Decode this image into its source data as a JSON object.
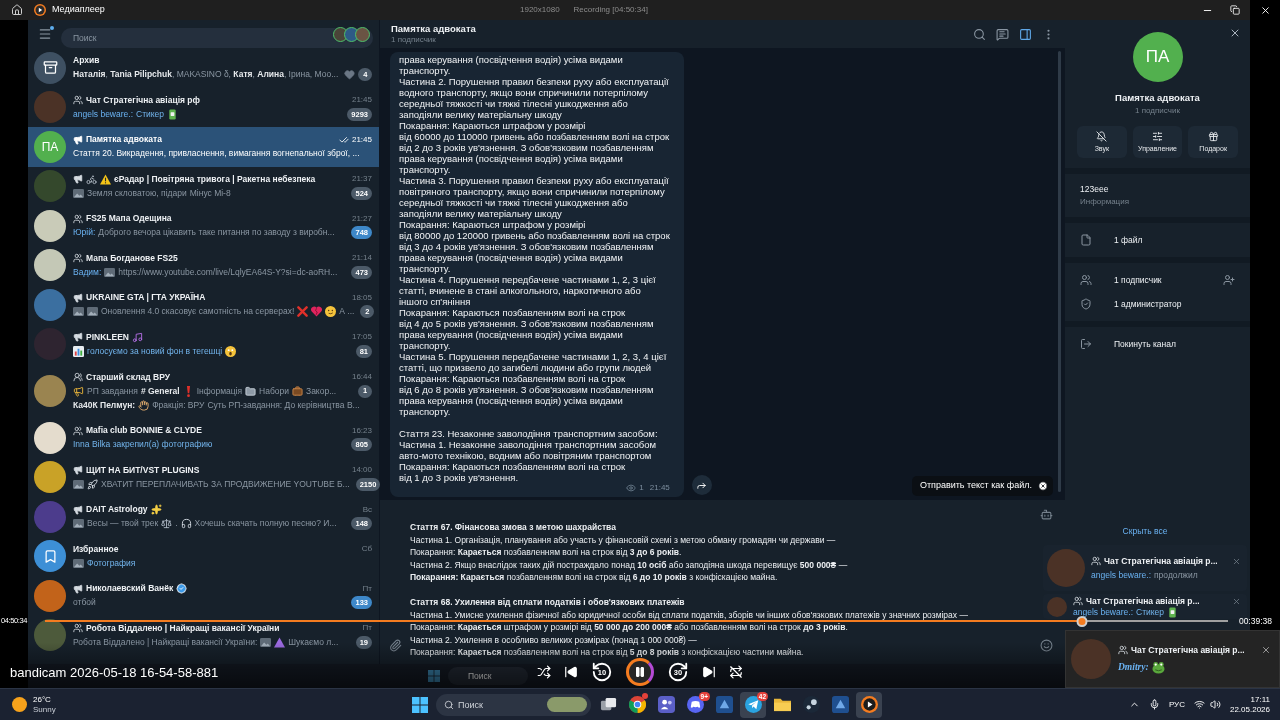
{
  "window": {
    "title": "Медиаплеер",
    "recording": {
      "resolution": "1920x1080",
      "status": "Recording [04:50:34]"
    }
  },
  "sidebar": {
    "menu_badge": true,
    "search": {
      "placeholder": "Поиск"
    },
    "stories": [
      {
        "color": "#4a4438"
      },
      {
        "color": "#2e5a86"
      },
      {
        "color": "#6a5444"
      }
    ],
    "chats": [
      {
        "avatar": {
          "kind": "archive",
          "color": "#3e5062"
        },
        "kind": "plain",
        "title": [
          {
            "kind": "text",
            "text": "Архив"
          }
        ],
        "read": false,
        "preview": [
          [
            {
              "kind": "rich",
              "text": "**Наталія**, **Tania Pilipchuk**, MAKASINO δ, **Катя**, **Алина**, Ірина, Моо..."
            }
          ]
        ],
        "extras": [
          {
            "kind": "heart"
          }
        ],
        "badge": {
          "text": "4",
          "muted": true
        },
        "selected": false
      },
      {
        "avatar": {
          "kind": "photo",
          "color": "#4b3226"
        },
        "kind": "group",
        "title": [
          {
            "kind": "text",
            "text": "Чат Стратегічна авіація рф"
          }
        ],
        "time": "21:45",
        "read": false,
        "preview": [
          [
            {
              "kind": "sender",
              "text": "angels beware.:"
            },
            {
              "kind": "media",
              "text": "Стикер"
            },
            {
              "kind": "sticker"
            }
          ]
        ],
        "badge": {
          "text": "9293",
          "muted": true
        },
        "selected": false
      },
      {
        "avatar": {
          "kind": "initials",
          "text": "ПА",
          "color": "#52b04e"
        },
        "kind": "channel",
        "title": [
          {
            "kind": "text",
            "text": "Памятка адвоката"
          }
        ],
        "time": "21:45",
        "read": true,
        "preview": [
          [
            {
              "kind": "text",
              "text": "Стаття 20. Викрадення, привласнення, вимагання вогнепальної зброї, ..."
            }
          ]
        ],
        "selected": true
      },
      {
        "avatar": {
          "kind": "photo",
          "color": "#34482c"
        },
        "kind": "channel",
        "title": [
          {
            "kind": "bike"
          },
          {
            "kind": "warning"
          },
          {
            "kind": "text",
            "text": "єРадар | Повітряна тривога | Ракетна небезпека"
          }
        ],
        "time": "21:37",
        "read": false,
        "preview": [
          [
            {
              "kind": "thumb"
            },
            {
              "kind": "text",
              "text": "Земля скловатою, підари"
            },
            {
              "kind": "text",
              "text": "Мінус Мі-8"
            }
          ]
        ],
        "badge": {
          "text": "524",
          "muted": true
        },
        "selected": false
      },
      {
        "avatar": {
          "kind": "photo",
          "color": "#c9cbb8"
        },
        "kind": "group",
        "title": [
          {
            "kind": "text",
            "text": "FS25 Мапа Одещина"
          }
        ],
        "time": "21:27",
        "read": false,
        "preview": [
          [
            {
              "kind": "sender",
              "text": "Юрій:"
            },
            {
              "kind": "text",
              "text": "Доброго вечора цікавить таке питання по заводу з виробн..."
            }
          ]
        ],
        "badge": {
          "text": "748",
          "muted": false
        },
        "selected": false
      },
      {
        "avatar": {
          "kind": "photo",
          "color": "#c4c8b6"
        },
        "kind": "group",
        "title": [
          {
            "kind": "text",
            "text": "Мапа Богданове FS25"
          }
        ],
        "time": "21:14",
        "read": false,
        "preview": [
          [
            {
              "kind": "sender",
              "text": "Вадим:"
            },
            {
              "kind": "thumb"
            },
            {
              "kind": "text",
              "text": "https://www.youtube.com/live/LqlyEA64S-Y?si=dc-aoRH..."
            }
          ]
        ],
        "badge": {
          "text": "473",
          "muted": true
        },
        "selected": false
      },
      {
        "avatar": {
          "kind": "photo",
          "color": "#3b6fa0"
        },
        "kind": "channel",
        "title": [
          {
            "kind": "text",
            "text": "UKRAINE GTA | ГТА УКРАЇНА"
          }
        ],
        "time": "18:05",
        "read": false,
        "preview": [
          [
            {
              "kind": "thumb"
            },
            {
              "kind": "thumb"
            },
            {
              "kind": "text",
              "text": "Оновлення 4.0 скасовує самотність на серверах!"
            },
            {
              "kind": "cross"
            },
            {
              "kind": "brokenheart"
            },
            {
              "kind": "face"
            },
            {
              "kind": "text",
              "text": "А ..."
            }
          ]
        ],
        "badge": {
          "text": "2",
          "muted": true
        },
        "selected": false
      },
      {
        "avatar": {
          "kind": "photo",
          "color": "#2e2430"
        },
        "kind": "channel",
        "title": [
          {
            "kind": "text",
            "text": "PINKLEEN"
          },
          {
            "kind": "notes"
          }
        ],
        "time": "17:05",
        "read": false,
        "preview": [
          [
            {
              "kind": "chart"
            },
            {
              "kind": "media",
              "text": "голосуємо за новий фон в тегешці"
            },
            {
              "kind": "scream"
            }
          ]
        ],
        "badge": {
          "text": "81",
          "muted": true
        },
        "selected": false
      },
      {
        "avatar": {
          "kind": "photo",
          "color": "#9a8450"
        },
        "kind": "forum",
        "title": [
          {
            "kind": "text",
            "text": "Старший склад ВРУ"
          }
        ],
        "time": "16:44",
        "read": false,
        "preview": [
          [
            {
              "kind": "megaphone"
            },
            {
              "kind": "text",
              "text": "РП завдання"
            },
            {
              "kind": "topic",
              "text": "# General"
            },
            {
              "kind": "exclaim"
            },
            {
              "kind": "text",
              "text": "Інформація"
            },
            {
              "kind": "folder"
            },
            {
              "kind": "text",
              "text": "Набори"
            },
            {
              "kind": "briefcase"
            },
            {
              "kind": "text",
              "text": "Закор..."
            }
          ],
          [
            {
              "kind": "author",
              "text": "Ка40К Пелмун:"
            },
            {
              "kind": "hand"
            },
            {
              "kind": "text",
              "text": "Фракція: ВРУ"
            },
            {
              "kind": "text",
              "text": "Суть РП-завдання: До керівництва В..."
            }
          ]
        ],
        "badge": {
          "text": "1",
          "muted": true
        },
        "selected": false
      },
      {
        "avatar": {
          "kind": "photo",
          "color": "#e4dccd"
        },
        "kind": "group",
        "title": [
          {
            "kind": "text",
            "text": "Mafia club BONNIE & CLYDE"
          }
        ],
        "time": "16:23",
        "read": false,
        "preview": [
          [
            {
              "kind": "media",
              "text": "Inna Bilka закрепил(а) фотографию"
            }
          ]
        ],
        "badge": {
          "text": "805",
          "muted": true
        },
        "selected": false
      },
      {
        "avatar": {
          "kind": "photo",
          "color": "#c9a227"
        },
        "kind": "channel",
        "title": [
          {
            "kind": "text",
            "text": "ЩИТ НА БИТ/VST PLUGINS"
          }
        ],
        "time": "14:00",
        "read": false,
        "preview": [
          [
            {
              "kind": "thumb"
            },
            {
              "kind": "rocket"
            },
            {
              "kind": "text",
              "text": "ХВАТИТ ПЕРЕПЛАЧИВАТЬ ЗА ПРОДВИЖЕНИЕ YOUTUBE Б..."
            }
          ]
        ],
        "badge": {
          "text": "2150",
          "muted": true
        },
        "selected": false
      },
      {
        "avatar": {
          "kind": "photo",
          "color": "#4c3c8c"
        },
        "kind": "channel",
        "title": [
          {
            "kind": "text",
            "text": "DAIT Astrology"
          },
          {
            "kind": "sparkles"
          }
        ],
        "time": "Вс",
        "read": false,
        "preview": [
          [
            {
              "kind": "thumb"
            },
            {
              "kind": "text",
              "text": "Весы — твой трек"
            },
            {
              "kind": "scales"
            },
            {
              "kind": "text",
              "text": "."
            },
            {
              "kind": "headphones"
            },
            {
              "kind": "text",
              "text": "Хочешь скачать полную песню? И..."
            }
          ]
        ],
        "badge": {
          "text": "148",
          "muted": true
        },
        "selected": false
      },
      {
        "avatar": {
          "kind": "bookmark",
          "color": "#3d8fd6"
        },
        "kind": "plain",
        "title": [
          {
            "kind": "text",
            "text": "Избранное"
          }
        ],
        "time": "Сб",
        "read": false,
        "preview": [
          [
            {
              "kind": "thumb"
            },
            {
              "kind": "media",
              "text": "Фотография"
            }
          ]
        ],
        "selected": false
      },
      {
        "avatar": {
          "kind": "photo",
          "color": "#c2631a"
        },
        "kind": "channel",
        "title": [
          {
            "kind": "text",
            "text": "Николаевский Ванёк"
          },
          {
            "kind": "verified"
          }
        ],
        "time": "Пт",
        "read": false,
        "preview": [
          [
            {
              "kind": "text",
              "text": "отбой"
            }
          ]
        ],
        "badge": {
          "text": "133",
          "muted": false
        },
        "selected": false
      },
      {
        "avatar": {
          "kind": "photo",
          "color": "#4d5a3b"
        },
        "kind": "group",
        "title": [
          {
            "kind": "text",
            "text": "Робота Віддалено | Найкращі вакансії України"
          }
        ],
        "time": "Пт",
        "read": false,
        "preview": [
          [
            {
              "kind": "text",
              "text": "Робота Віддалено | Найкращі вакансії України:"
            },
            {
              "kind": "thumb"
            },
            {
              "kind": "triangle"
            },
            {
              "kind": "text",
              "text": "Шукаємо л..."
            }
          ]
        ],
        "badge": {
          "text": "19",
          "muted": true
        },
        "selected": false
      }
    ]
  },
  "chat": {
    "title": "Памятка адвоката",
    "subtitle": "1 подписчик",
    "actions": [
      {
        "kind": "search",
        "on": false
      },
      {
        "kind": "comments",
        "on": false
      },
      {
        "kind": "sidebar",
        "on": true
      },
      {
        "kind": "more",
        "on": false
      }
    ],
    "message": {
      "text": "права керування (посвідчення водія) усіма видами\nтранспорту.\nЧастина 2. Порушення правил безпеки руху або експлуатації\nводного транспорту, якщо вони спричинили потерпілому\nсередньої тяжкості чи тяжкі тілесні ушкодження або\nзаподіяли велику матеріальну шкоду\nПокарання: Караються штрафом у розмірі\nвід 60000 до 110000 гривень або позбавленням волі на строк\nвід 2 до 3 років ув'язнення. З обов'язковим позбавленням\nправа керування (посвідчення водія) усіма видами\nтранспорту.\nЧастина 3. Порушення правил безпеки руху або експлуатації\nповітряного транспорту, якщо вони спричинили потерпілому\nсередньої тяжкості чи тяжкі тілесні ушкодження або\nзаподіяли велику матеріальну шкоду\nПокарання: Караються штрафом у розмірі\nвід 80000 до 120000 гривень або позбавленням волі на строк\nвід 3 до 4 років ув'язнення. З обов'язковим позбавленням\nправа керування (посвідчення водія) усіма видами\nтранспорту.\nЧастина 4. Порушення передбачене частинами 1, 2, 3 цієї\nстатті, вчинене в стані алкогольного, наркотичного або\nіншого сп'яніння\nПокарання: Караються позбавленням волі на строк\nвід 4 до 5 років ув'язнення. З обов'язковим позбавленням\nправа керування (посвідчення водія) усіма видами\nтранспорту.\nЧастина 5. Порушення передбачене частинами 1, 2, 3, 4 цієї\nстатті, що призвело до загибелі людини або групи людей\nПокарання: Караються позбавленням волі на строк\nвід 6 до 8 років ув'язнення. З обов'язковим позбавленням\nправа керування (посвідчення водія) усіма видами\nтранспорту.\n\nСтаття 23. Незаконне заволодіння транспортним засобом:\nЧастина 1. Незаконне заволодіння транспортним засобом\nавто-мото технікою, водним або повітряним транспортом\nПокарання: Караються позбавленням волі на строк\nвід 1 до 3 років ув'язнення.",
      "views": "1",
      "time": "21:45"
    },
    "tooltip": "Отправить текст как файл.",
    "draft": {
      "value": "**Стаття 67. Фінансова змова з метою шахрайства**\nЧастина 1. Організація, планування або участь у фінансовій схемі з метою обману громадян чи держави —\nПокарання: **Карається** позбавленням волі на строк від **3 до 6 років**.\nЧастина 2. Якщо внаслідок таких дій постраждало понад **10 осіб** або заподіяна шкода перевищує **500 000₴** —\n**Покарання: Карається** позбавленням волі на строк від **6 до 10 років** з конфіскацією майна.\n\n**Стаття 68. Ухилення від сплати податків і обов'язкових платежів**\nЧастина 1. Умисне ухилення фізичної або юридичної особи від сплати податків, зборів чи інших обов'язкових платежів у значних розмірах —\nПокарання: **Карається** штрафом у розмірі від **50 000 до 200 000₴** або позбавленням волі на строк **до 3 років**.\nЧастина 2. Ухилення в особливо великих розмірах (понад 1 000 000₴) —\nПокарання: **Карається** позбавленням волі на строк від **5 до 8 років** з конфіскацією частини майна."
    }
  },
  "info_panel": {
    "avatar": {
      "text": "ПА",
      "color": "#52b04e"
    },
    "name": "Памятка адвоката",
    "subtitle": "1 подписчик",
    "actions": [
      {
        "kind": "mute",
        "label": "Звук"
      },
      {
        "kind": "manage",
        "label": "Управление"
      },
      {
        "kind": "gift",
        "label": "Подарок"
      }
    ],
    "about": {
      "value": "123eee",
      "label": "Информация"
    },
    "sections": [
      [
        {
          "kind": "files",
          "label": "1 файл",
          "add": false
        }
      ],
      [
        {
          "kind": "members",
          "label": "1 подписчик",
          "add": true
        },
        {
          "kind": "admins",
          "label": "1 администратор",
          "add": false
        }
      ],
      [
        {
          "kind": "leave",
          "label": "Покинуть канал",
          "add": false
        }
      ]
    ]
  },
  "notifications": {
    "hide_all": "Скрыть все",
    "items": [
      {
        "kind": "group",
        "avatar": {
          "color": "#4b3226"
        },
        "title": "Чат Стратегічна авіація р...",
        "sender": "angels beware.:",
        "preview": [
          {
            "kind": "text",
            "text": "продолжил"
          }
        ]
      },
      {
        "kind": "group",
        "avatar": {
          "color": "#4b3226"
        },
        "title": "Чат Стратегічна авіація р...",
        "sender": "angels beware.:",
        "preview": [
          {
            "kind": "media",
            "text": "Стикер"
          },
          {
            "kind": "sticker"
          }
        ]
      }
    ]
  },
  "recorded_taskbar": {
    "search": {
      "placeholder": "Поиск"
    }
  },
  "player": {
    "elapsed": "04:50:34",
    "remaining": "00:39:38",
    "level": 0.877,
    "title": "bandicam 2026-05-18 16-54-58-881",
    "controls": [
      {
        "kind": "shuffle"
      },
      {
        "kind": "previous"
      },
      {
        "kind": "rewind",
        "label": "10"
      },
      {
        "kind": "pause"
      },
      {
        "kind": "forward",
        "label": "30"
      },
      {
        "kind": "next"
      },
      {
        "kind": "repeat_off"
      }
    ]
  },
  "toast": {
    "kind": "group",
    "avatar": {
      "color": "#4b3226"
    },
    "title": "Чат Стратегічна авіація р...",
    "sender": "Dmitry:",
    "preview": [
      {
        "kind": "frog"
      }
    ]
  },
  "taskbar": {
    "weather": {
      "temperature": "26°C",
      "condition": "Sunny"
    },
    "search": {
      "placeholder": "Поиск"
    },
    "apps": [
      {
        "kind": "task_view",
        "active": false,
        "dot": false
      },
      {
        "kind": "browser",
        "active": false,
        "dot": true
      },
      {
        "kind": "people",
        "active": false,
        "dot": false
      },
      {
        "kind": "gamepad",
        "active": false,
        "dot": false,
        "badge": "9+"
      },
      {
        "kind": "tile",
        "active": false,
        "dot": false
      },
      {
        "kind": "plane",
        "active": true,
        "dot": false,
        "badge": "42"
      },
      {
        "kind": "folder",
        "active": false,
        "dot": false
      },
      {
        "kind": "disc",
        "active": false,
        "dot": false
      },
      {
        "kind": "tile",
        "active": false,
        "dot": false
      },
      {
        "kind": "player",
        "active": true,
        "dot": false
      }
    ],
    "tray": {
      "language": "РУС",
      "time": "17:11",
      "date": "22.05.2026"
    }
  }
}
